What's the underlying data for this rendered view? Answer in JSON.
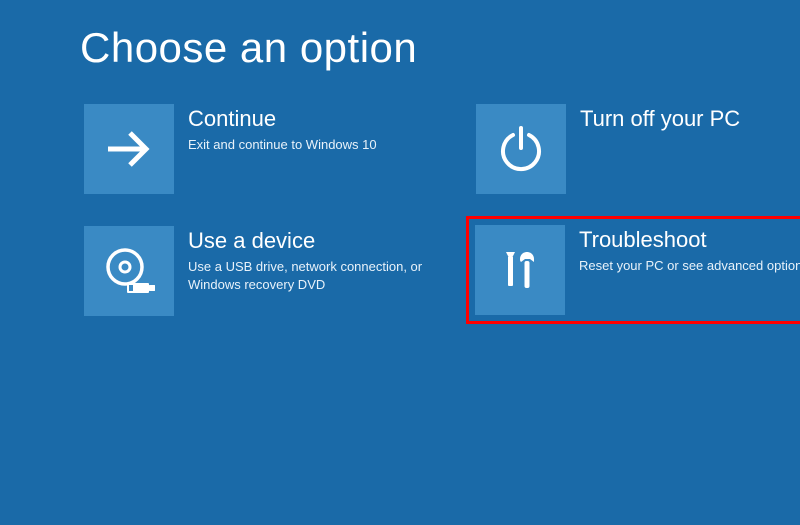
{
  "title": "Choose an option",
  "options": {
    "continue": {
      "title": "Continue",
      "desc": "Exit and continue to Windows 10"
    },
    "turnoff": {
      "title": "Turn off your PC",
      "desc": ""
    },
    "device": {
      "title": "Use a device",
      "desc": "Use a USB drive, network connection, or Windows recovery DVD"
    },
    "troubleshoot": {
      "title": "Troubleshoot",
      "desc": "Reset your PC or see advanced options"
    }
  }
}
